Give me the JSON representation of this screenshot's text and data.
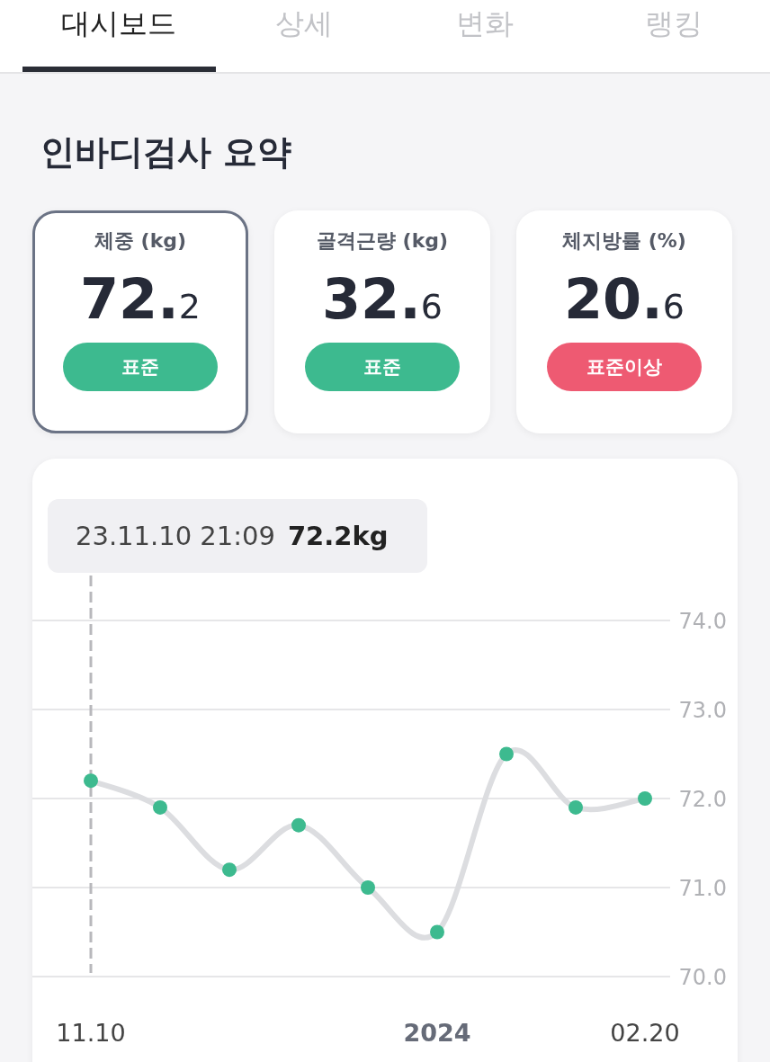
{
  "tabs": [
    {
      "label": "대시보드",
      "selected": true
    },
    {
      "label": "상세",
      "selected": false
    },
    {
      "label": "변화",
      "selected": false
    },
    {
      "label": "랭킹",
      "selected": false
    }
  ],
  "title": "인바디검사 요약",
  "cards": [
    {
      "label": "체중 (kg)",
      "value_main": "72.",
      "value_decimal": "2",
      "status": "표준",
      "color": "#3dba8f",
      "selected": true
    },
    {
      "label": "골격근량 (kg)",
      "value_main": "32.",
      "value_decimal": "6",
      "status": "표준",
      "color": "#3dba8f",
      "selected": false
    },
    {
      "label": "체지방률 (%)",
      "value_main": "20.",
      "value_decimal": "6",
      "status": "표준이상",
      "color": "#ee5a72",
      "selected": false
    }
  ],
  "chart": {
    "tooltip": {
      "date": "23.11.10 21:09",
      "value": "72.2kg"
    },
    "chart_data": {
      "type": "line",
      "categories": [
        "11.10",
        null,
        null,
        null,
        null,
        "2024",
        null,
        null,
        "02.20"
      ],
      "grid": true,
      "series": [
        {
          "color": "#3dba8f",
          "marker": "circle",
          "values": [
            72.2,
            71.9,
            71.2,
            71.7,
            71.0,
            70.5,
            72.5,
            71.9,
            72.0
          ]
        }
      ],
      "ylim": [
        70,
        74
      ],
      "yticks": [
        {
          "value": 74,
          "label": "74.0"
        },
        {
          "value": 73,
          "label": "73.0"
        },
        {
          "value": 72,
          "label": "72.0"
        },
        {
          "value": 71,
          "label": "71.0"
        },
        {
          "value": 70,
          "label": "70.0"
        }
      ],
      "annotations": [
        {
          "x": "11.10"
        }
      ]
    }
  }
}
